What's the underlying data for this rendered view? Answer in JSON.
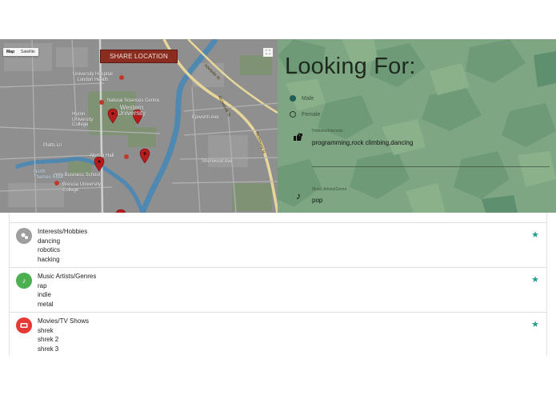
{
  "map": {
    "type_buttons": [
      "Map",
      "Satellite"
    ],
    "share_button": "SHARE LOCATION",
    "labels": {
      "hospital": "University Hospital\nLondon Health",
      "natural_sciences": "Natural Sciences Centre",
      "western": "Western\nUniversity",
      "huron": "Huron\nUniversity\nCollege",
      "alumni": "Alumni Hall",
      "ivey": "Ivey Business School",
      "brescia": "Brescia University\nCollege",
      "north_thames": "North\nThames River",
      "richmond1": "Richmond St",
      "richmond2": "Richmond St",
      "adelaide": "Adelaide St",
      "epworth": "Epworth Ave",
      "platts": "Platts Ln",
      "sherwood": "Sherwood Ave"
    }
  },
  "profile": {
    "heading": "Looking For:",
    "gender_options": [
      {
        "label": "Male",
        "selected": true
      },
      {
        "label": "Female",
        "selected": false
      }
    ],
    "hobbies": {
      "label": "Hobbies/Interests",
      "value": "programming,rock climbing,dancing",
      "icon": "thumbs-icon"
    },
    "music": {
      "label": "Music Artists/Genre",
      "value": "pop",
      "icon": "music-note-icon"
    }
  },
  "list": {
    "items": [
      {
        "title": "Interests/Hobbies",
        "lines": [
          "dancing",
          "robotics",
          "hacking"
        ],
        "icon": "interests-icon",
        "color": "#9e9e9e"
      },
      {
        "title": "Music Artists/Genres",
        "lines": [
          "rap",
          "indie",
          "metal"
        ],
        "icon": "music-note-icon",
        "color": "#4caf50"
      },
      {
        "title": "Movies/TV Shows",
        "lines": [
          "shrek",
          "shrek 2",
          "shrek 3"
        ],
        "icon": "tv-icon",
        "color": "#e53935"
      }
    ]
  },
  "colors": {
    "accent": "#2a9c8c",
    "share_button": "#8a2c1f",
    "panel": "#7ca380"
  }
}
